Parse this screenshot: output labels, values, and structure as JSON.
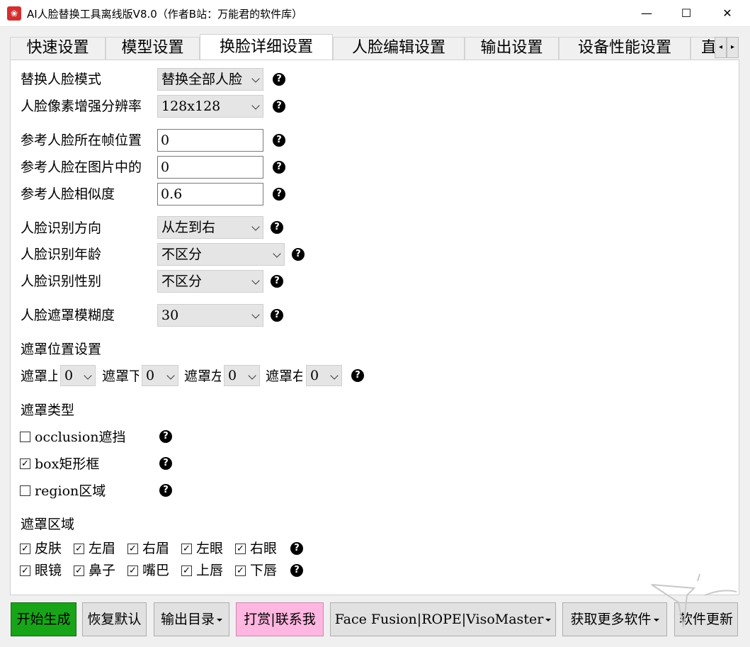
{
  "window": {
    "title": "AI人脸替换工具离线版V8.0（作者B站：万能君的软件库）",
    "minimize_glyph": "—",
    "maximize_glyph": "☐",
    "close_glyph": "✕"
  },
  "tabs": [
    {
      "label": "快速设置"
    },
    {
      "label": "模型设置"
    },
    {
      "label": "换脸详细设置"
    },
    {
      "label": "人脸编辑设置"
    },
    {
      "label": "输出设置"
    },
    {
      "label": "设备性能设置"
    },
    {
      "label": "直"
    }
  ],
  "tab_scroll": {
    "left": "◂",
    "right": "▸"
  },
  "fields": {
    "replace_mode": {
      "label": "替换人脸模式",
      "value": "替换全部人脸"
    },
    "enhance_res": {
      "label": "人脸像素增强分辨率",
      "value": "128x128"
    },
    "ref_frame": {
      "label": "参考人脸所在帧位置",
      "value": "0"
    },
    "ref_in_image": {
      "label": "参考人脸在图片中的",
      "value": "0"
    },
    "ref_similarity": {
      "label": "参考人脸相似度",
      "value": "0.6"
    },
    "direction": {
      "label": "人脸识别方向",
      "value": "从左到右"
    },
    "age": {
      "label": "人脸识别年龄",
      "value": "不区分"
    },
    "gender": {
      "label": "人脸识别性别",
      "value": "不区分"
    },
    "mask_blur": {
      "label": "人脸遮罩模糊度",
      "value": "30"
    }
  },
  "mask_position": {
    "title": "遮罩位置设置",
    "items": [
      {
        "label": "遮罩上",
        "value": "0"
      },
      {
        "label": "遮罩下",
        "value": "0"
      },
      {
        "label": "遮罩左",
        "value": "0"
      },
      {
        "label": "遮罩右",
        "value": "0"
      }
    ]
  },
  "mask_type": {
    "title": "遮罩类型",
    "items": [
      {
        "label": "occlusion遮挡",
        "checked": false,
        "mark": ""
      },
      {
        "label": "box矩形框",
        "checked": true,
        "mark": "✓"
      },
      {
        "label": "region区域",
        "checked": false,
        "mark": ""
      }
    ]
  },
  "mask_region": {
    "title": "遮罩区域",
    "row1": [
      {
        "label": "皮肤",
        "mark": "✓"
      },
      {
        "label": "左眉",
        "mark": "✓"
      },
      {
        "label": "右眉",
        "mark": "✓"
      },
      {
        "label": "左眼",
        "mark": "✓"
      },
      {
        "label": "右眼",
        "mark": "✓"
      }
    ],
    "row2": [
      {
        "label": "眼镜",
        "mark": "✓"
      },
      {
        "label": "鼻子",
        "mark": "✓"
      },
      {
        "label": "嘴巴",
        "mark": "✓"
      },
      {
        "label": "上唇",
        "mark": "✓"
      },
      {
        "label": "下唇",
        "mark": "✓"
      }
    ]
  },
  "help_glyph": "?",
  "buttons": {
    "start": "开始生成",
    "restore": "恢复默认",
    "output_dir": "输出目录",
    "donate": "打赏|联系我",
    "fusion": "Face Fusion|ROPE|VisoMaster",
    "more": "获取更多软件",
    "update": "软件更新"
  },
  "colors": {
    "start_btn": "#18a418",
    "donate_btn": "#ffb6e0",
    "panel": "#ffffff",
    "window_bg": "#f0f0f0"
  }
}
